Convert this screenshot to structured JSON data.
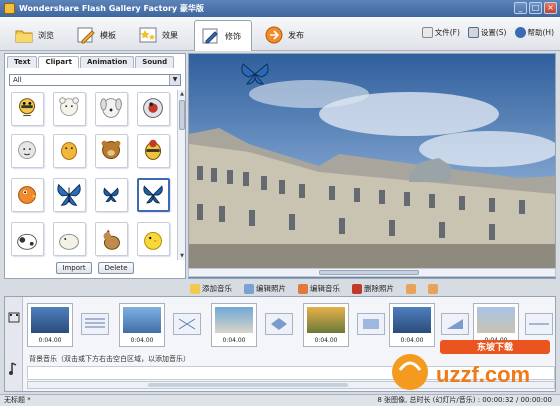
{
  "window": {
    "title": "Wondershare Flash Gallery Factory 豪华版"
  },
  "tabs": [
    {
      "label": "浏览",
      "icon": "folder-icon"
    },
    {
      "label": "模板",
      "icon": "template-pencil-icon"
    },
    {
      "label": "效果",
      "icon": "effects-stars-icon"
    },
    {
      "label": "修饰",
      "icon": "decorate-pencil-icon"
    },
    {
      "label": "发布",
      "icon": "publish-globe-icon"
    }
  ],
  "right_menu": {
    "file": "文件(F)",
    "settings": "设置(S)",
    "help": "帮助(H)"
  },
  "panel": {
    "subtabs": [
      "Text",
      "Clipart",
      "Animation",
      "Sound"
    ],
    "active_subtab": "Clipart",
    "filter_value": "All",
    "import_label": "Import",
    "delete_label": "Delete"
  },
  "actions": {
    "add_music": "添加音乐",
    "edit_photo": "编辑照片",
    "edit_music": "编辑音乐",
    "delete_photo": "删除照片"
  },
  "timeline": {
    "thumbs": [
      {
        "duration": "0:04.00"
      },
      {
        "duration": "0:04.00"
      },
      {
        "duration": "0:04.00"
      },
      {
        "duration": "0:04.00"
      },
      {
        "duration": "0:04.00"
      },
      {
        "duration": "0:04.00"
      },
      {
        "duration": "0:04.00"
      }
    ],
    "music_hint": "背景音乐（双击或下方右击空白区域，以添加音乐）"
  },
  "status": {
    "left": "无标题 *",
    "right": "8 张图像, 总时长 (幻灯片/音乐) : 00:00:32 / 00:00:00"
  },
  "watermark": {
    "text": "uzzf.com",
    "tag": "东坡下载"
  },
  "colors": {
    "accent": "#3e679f",
    "selected": "#3a6bb3"
  }
}
